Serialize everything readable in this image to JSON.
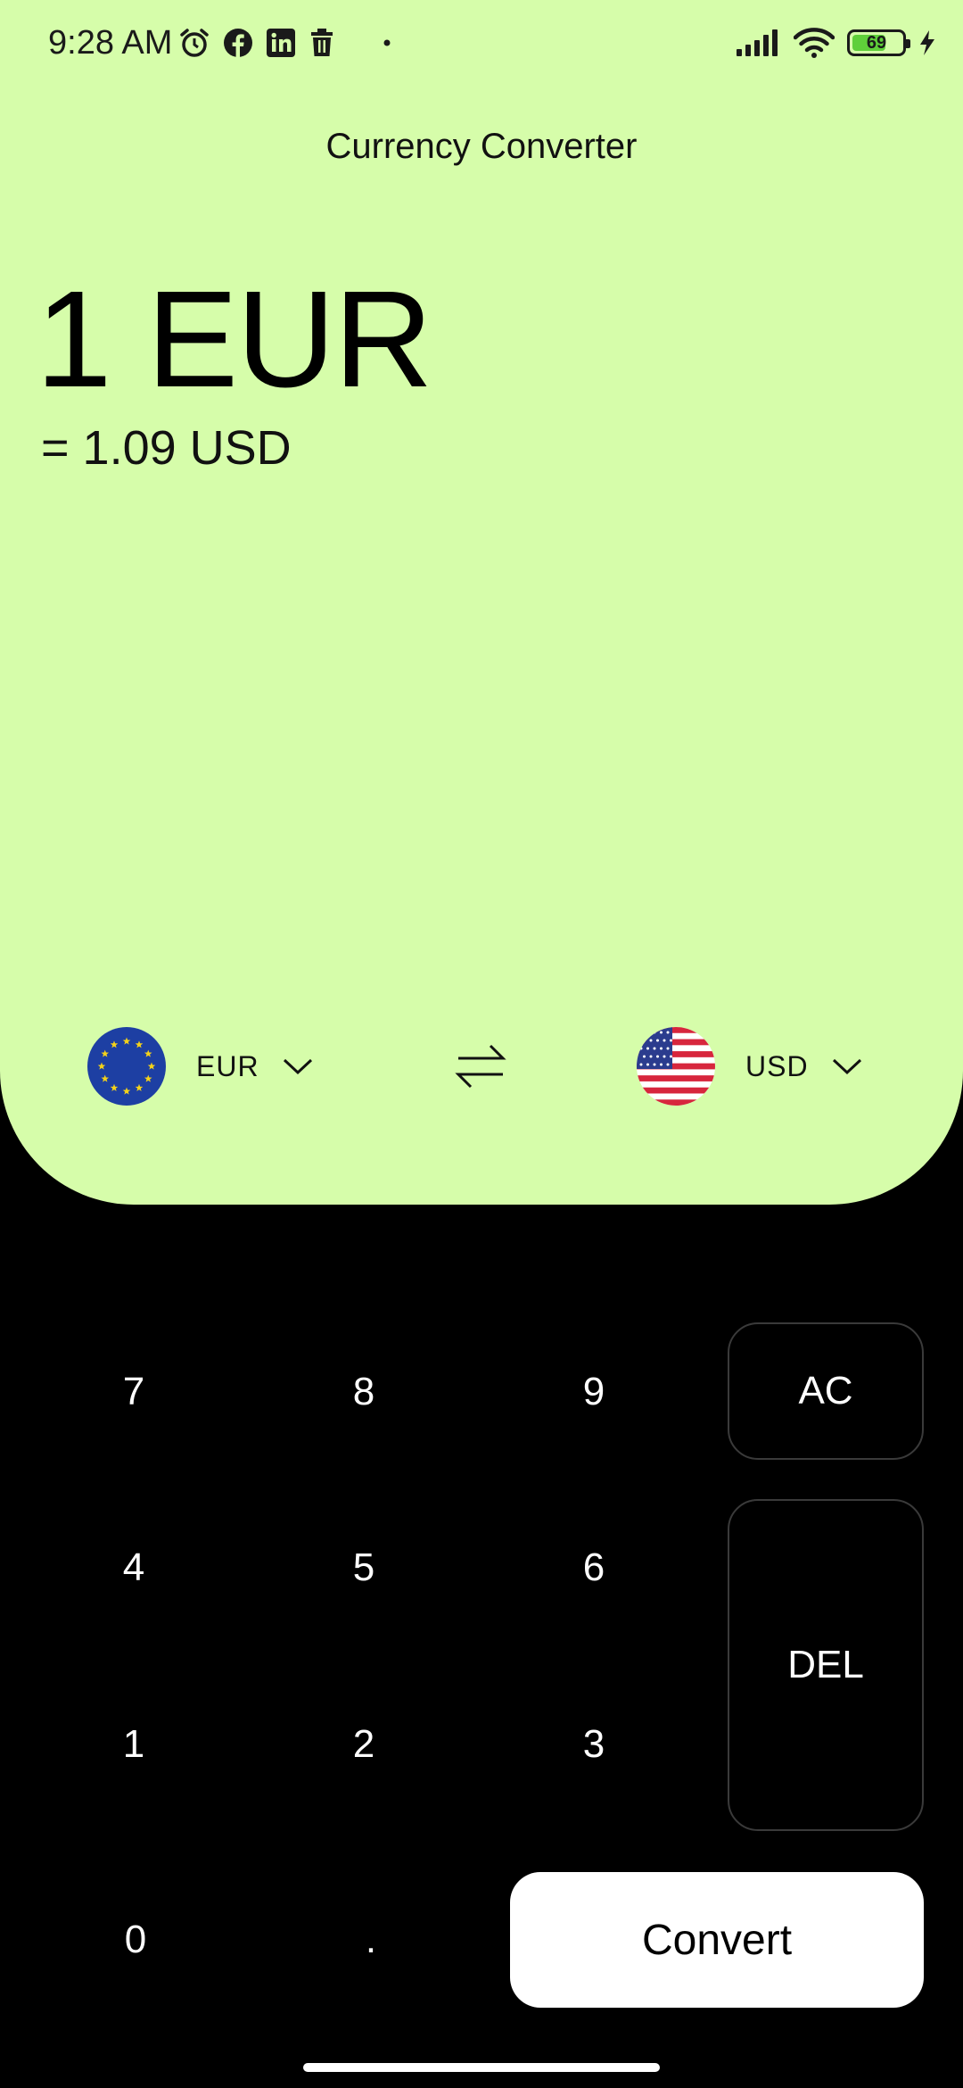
{
  "status_bar": {
    "time": "9:28 AM",
    "battery_level": "69",
    "battery_fraction": 0.69,
    "icons_left": [
      "alarm-icon",
      "facebook-icon",
      "linkedin-icon",
      "trash-icon",
      "dot-icon"
    ],
    "icons_right": [
      "signal-icon",
      "wifi-icon",
      "battery-icon",
      "charging-icon"
    ]
  },
  "app": {
    "title": "Currency Converter"
  },
  "display": {
    "amount": "1 EUR",
    "result": "= 1.09 USD"
  },
  "selectors": {
    "from": {
      "code": "EUR",
      "flag": "eu-flag-icon"
    },
    "to": {
      "code": "USD",
      "flag": "us-flag-icon"
    },
    "swap_icon": "swap-arrows-icon"
  },
  "keypad": {
    "k7": "7",
    "k8": "8",
    "k9": "9",
    "k4": "4",
    "k5": "5",
    "k6": "6",
    "k1": "1",
    "k2": "2",
    "k3": "3",
    "k0": "0",
    "kdot": ".",
    "clear": "AC",
    "delete": "DEL",
    "convert": "Convert"
  },
  "colors": {
    "panel_bg": "#d6fdaa",
    "keypad_bg": "#000000",
    "key_border": "#3a3a3a",
    "convert_bg": "#ffffff"
  }
}
